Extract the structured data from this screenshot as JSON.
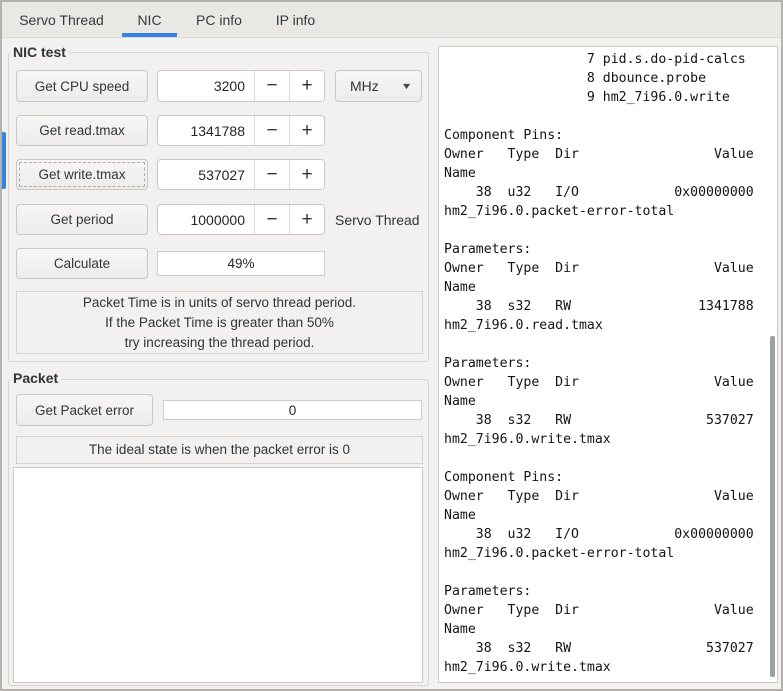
{
  "tabs": {
    "servo_thread": "Servo Thread",
    "nic": "NIC",
    "pc_info": "PC info",
    "ip_info": "IP info",
    "active_tab": "NIC"
  },
  "icons": {
    "minus": "−",
    "plus": "+",
    "dropdown_arrow": "▼"
  },
  "colors": {
    "accent_blue": "#3584e4",
    "panel_white": "#ffffff"
  },
  "nic_test": {
    "title": "NIC test",
    "rows": [
      {
        "button": "Get CPU speed",
        "value": "3200",
        "unit": "MHz"
      },
      {
        "button": "Get read.tmax",
        "value": "1341788"
      },
      {
        "button": "Get write.tmax",
        "value": "537027"
      },
      {
        "button": "Get period",
        "value": "1000000",
        "side_label": "Servo Thread"
      }
    ],
    "calculate_button": "Calculate",
    "packet_time_percent": "49%",
    "info_lines": {
      "line1": "Packet Time is in units of servo thread period.",
      "line2": "If the Packet Time is greater than 50%",
      "line3": "try increasing the thread period."
    }
  },
  "packet": {
    "title": "Packet",
    "button": "Get Packet error",
    "error_value": "0",
    "info": "The ideal state is when the packet error is 0"
  },
  "output_panel": {
    "text": "                  7 pid.s.do-pid-calcs\n                  8 dbounce.probe\n                  9 hm2_7i96.0.write\n\nComponent Pins:\nOwner   Type  Dir                 Value\nName\n    38  u32   I/O            0x00000000\nhm2_7i96.0.packet-error-total\n\nParameters:\nOwner   Type  Dir                 Value\nName\n    38  s32   RW                1341788\nhm2_7i96.0.read.tmax\n\nParameters:\nOwner   Type  Dir                 Value\nName\n    38  s32   RW                 537027\nhm2_7i96.0.write.tmax\n\nComponent Pins:\nOwner   Type  Dir                 Value\nName\n    38  u32   I/O            0x00000000\nhm2_7i96.0.packet-error-total\n\nParameters:\nOwner   Type  Dir                 Value\nName\n    38  s32   RW                 537027\nhm2_7i96.0.write.tmax"
  }
}
